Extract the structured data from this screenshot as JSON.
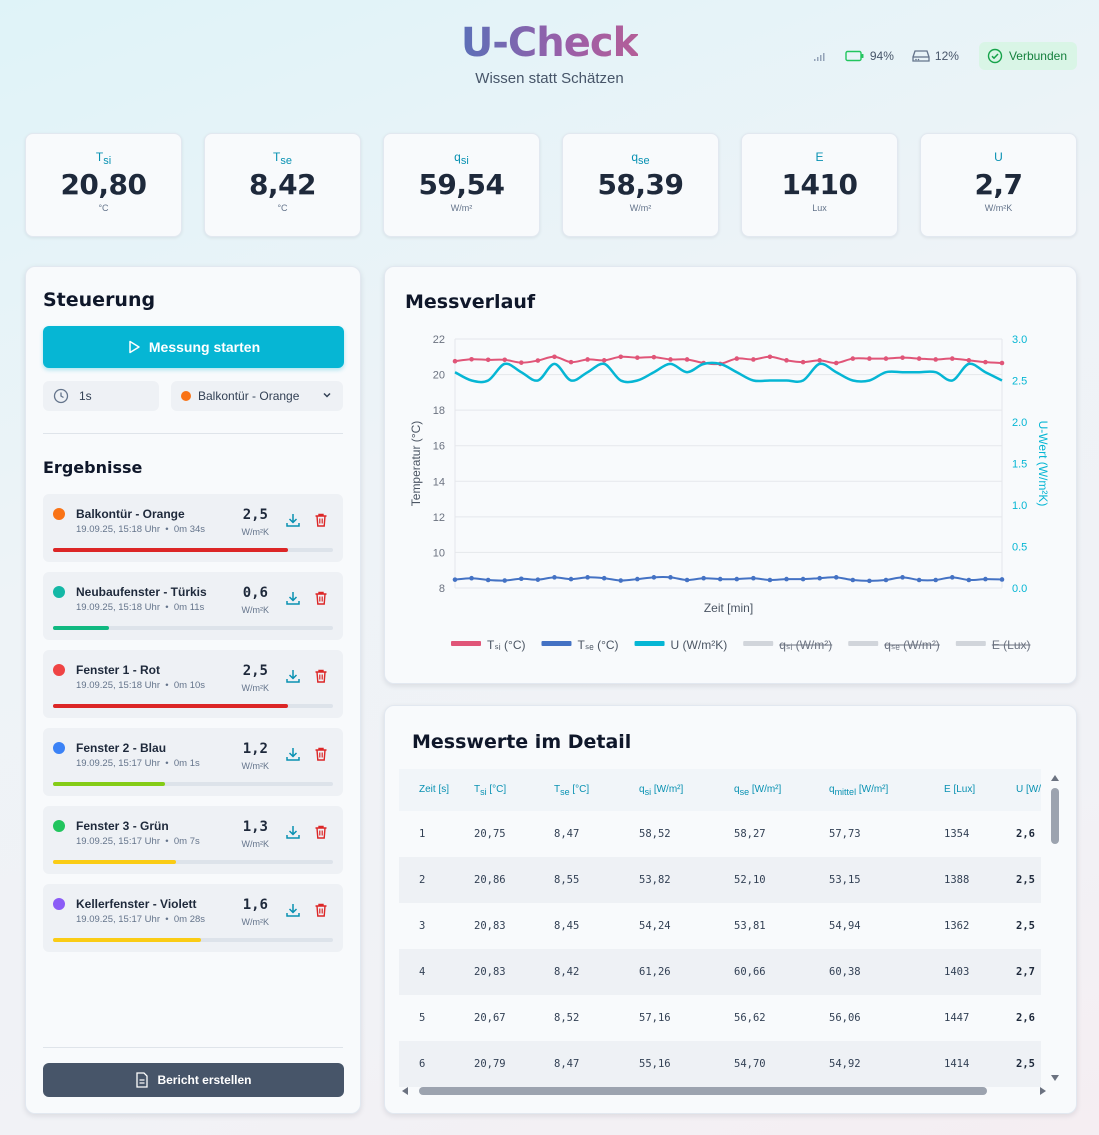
{
  "header": {
    "title": "U-Check",
    "tagline": "Wissen statt Schätzen",
    "battery": "94%",
    "storage": "12%",
    "connection": "Verbunden"
  },
  "metrics": [
    {
      "label": "T",
      "sub": "si",
      "value": "20,80",
      "unit": "°C"
    },
    {
      "label": "T",
      "sub": "se",
      "value": "8,42",
      "unit": "°C"
    },
    {
      "label": "q",
      "sub": "si",
      "value": "59,54",
      "unit": "W/m²"
    },
    {
      "label": "q",
      "sub": "se",
      "value": "58,39",
      "unit": "W/m²"
    },
    {
      "label": "E",
      "sub": "",
      "value": "1410",
      "unit": "Lux"
    },
    {
      "label": "U",
      "sub": "",
      "value": "2,7",
      "unit": "W/m²K"
    }
  ],
  "control": {
    "title": "Steuerung",
    "start_label": "Messung starten",
    "interval": "1s",
    "selected_object": "Balkontür - Orange",
    "results_title": "Ergebnisse",
    "report_label": "Bericht erstellen"
  },
  "results": [
    {
      "name": "Balkontür - Orange",
      "meta": "19.09.25, 15:18 Uhr  •  0m 34s",
      "value": "2,5",
      "unit": "W/m²K",
      "dot": "#f97316",
      "bar": "#dc2626",
      "fill": 0.84
    },
    {
      "name": "Neubaufenster - Türkis",
      "meta": "19.09.25, 15:18 Uhr  •  0m 11s",
      "value": "0,6",
      "unit": "W/m²K",
      "dot": "#14b8a6",
      "bar": "#10b981",
      "fill": 0.2
    },
    {
      "name": "Fenster 1 - Rot",
      "meta": "19.09.25, 15:18 Uhr  •  0m 10s",
      "value": "2,5",
      "unit": "W/m²K",
      "dot": "#ef4444",
      "bar": "#dc2626",
      "fill": 0.84
    },
    {
      "name": "Fenster 2 - Blau",
      "meta": "19.09.25, 15:17 Uhr  •  0m 1s",
      "value": "1,2",
      "unit": "W/m²K",
      "dot": "#3b82f6",
      "bar": "#84cc16",
      "fill": 0.4
    },
    {
      "name": "Fenster 3 - Grün",
      "meta": "19.09.25, 15:17 Uhr  •  0m 7s",
      "value": "1,3",
      "unit": "W/m²K",
      "dot": "#22c55e",
      "bar": "#facc15",
      "fill": 0.44
    },
    {
      "name": "Kellerfenster - Violett",
      "meta": "19.09.25, 15:17 Uhr  •  0m 28s",
      "value": "1,6",
      "unit": "W/m²K",
      "dot": "#8b5cf6",
      "bar": "#facc15",
      "fill": 0.53
    }
  ],
  "chart_title": "Messverlauf",
  "chart_data": {
    "type": "line",
    "title": "Messverlauf",
    "xlabel": "Zeit [min]",
    "ylabel": "Temperatur (°C)",
    "y2label": "U-Wert (W/m²K)",
    "ylim": [
      8,
      22
    ],
    "y2lim": [
      0,
      3
    ],
    "yticks": [
      "22",
      "20",
      "18",
      "16",
      "14",
      "12",
      "10",
      "8"
    ],
    "y2ticks": [
      "3.0",
      "2.5",
      "2.0",
      "1.5",
      "1.0",
      "0.5",
      "0.0"
    ],
    "grid": true,
    "legend_position": "bottom",
    "x": [
      1,
      2,
      3,
      4,
      5,
      6,
      7,
      8,
      9,
      10,
      11,
      12,
      13,
      14,
      15,
      16,
      17,
      18,
      19,
      20,
      21,
      22,
      23,
      24,
      25,
      26,
      27,
      28,
      29,
      30,
      31,
      32,
      33,
      34
    ],
    "series": [
      {
        "name": "Tₛᵢ (°C)",
        "axis": "left",
        "color": "#e05578",
        "markers": true,
        "values": [
          20.75,
          20.86,
          20.83,
          20.83,
          20.67,
          20.79,
          21.0,
          20.7,
          20.85,
          20.8,
          21.0,
          20.95,
          20.98,
          20.85,
          20.85,
          20.65,
          20.6,
          20.9,
          20.85,
          21.0,
          20.8,
          20.7,
          20.8,
          20.65,
          20.9,
          20.9,
          20.9,
          20.95,
          20.9,
          20.85,
          20.9,
          20.8,
          20.7,
          20.65
        ]
      },
      {
        "name": "Tₛₑ (°C)",
        "axis": "left",
        "color": "#4472c4",
        "markers": true,
        "values": [
          8.47,
          8.55,
          8.45,
          8.42,
          8.52,
          8.47,
          8.6,
          8.5,
          8.6,
          8.55,
          8.42,
          8.5,
          8.6,
          8.6,
          8.45,
          8.55,
          8.5,
          8.5,
          8.55,
          8.45,
          8.5,
          8.5,
          8.55,
          8.6,
          8.45,
          8.4,
          8.45,
          8.6,
          8.45,
          8.45,
          8.6,
          8.45,
          8.5,
          8.48
        ]
      },
      {
        "name": "U (W/m²K)",
        "axis": "right",
        "color": "#06b6d4",
        "markers": false,
        "values": [
          2.6,
          2.5,
          2.5,
          2.7,
          2.6,
          2.5,
          2.7,
          2.5,
          2.6,
          2.7,
          2.5,
          2.5,
          2.6,
          2.7,
          2.6,
          2.7,
          2.7,
          2.6,
          2.5,
          2.5,
          2.5,
          2.5,
          2.7,
          2.6,
          2.5,
          2.5,
          2.6,
          2.6,
          2.6,
          2.6,
          2.5,
          2.7,
          2.6,
          2.5
        ]
      },
      {
        "name": "qₛᵢ (W/m²)",
        "hidden": true,
        "color": "#d1d5db",
        "values": []
      },
      {
        "name": "qₛₑ (W/m²)",
        "hidden": true,
        "color": "#d1d5db",
        "values": []
      },
      {
        "name": "E (Lux)",
        "hidden": true,
        "color": "#d1d5db",
        "values": []
      }
    ]
  },
  "table": {
    "title": "Messwerte im Detail",
    "headers": [
      {
        "main": "Zeit [s]",
        "sub": "",
        "rest": ""
      },
      {
        "main": "T",
        "sub": "si",
        "rest": " [°C]"
      },
      {
        "main": "T",
        "sub": "se",
        "rest": " [°C]"
      },
      {
        "main": "q",
        "sub": "si",
        "rest": " [W/m²]"
      },
      {
        "main": "q",
        "sub": "se",
        "rest": " [W/m²]"
      },
      {
        "main": "q",
        "sub": "mittel",
        "rest": " [W/m²]"
      },
      {
        "main": "E [Lux]",
        "sub": "",
        "rest": ""
      },
      {
        "main": "U [W/",
        "sub": "",
        "rest": ""
      }
    ],
    "rows": [
      [
        "1",
        "20,75",
        "8,47",
        "58,52",
        "58,27",
        "57,73",
        "1354",
        "2,6"
      ],
      [
        "2",
        "20,86",
        "8,55",
        "53,82",
        "52,10",
        "53,15",
        "1388",
        "2,5"
      ],
      [
        "3",
        "20,83",
        "8,45",
        "54,24",
        "53,81",
        "54,94",
        "1362",
        "2,5"
      ],
      [
        "4",
        "20,83",
        "8,42",
        "61,26",
        "60,66",
        "60,38",
        "1403",
        "2,7"
      ],
      [
        "5",
        "20,67",
        "8,52",
        "57,16",
        "56,62",
        "56,06",
        "1447",
        "2,6"
      ],
      [
        "6",
        "20,79",
        "8,47",
        "55,16",
        "54,70",
        "54,92",
        "1414",
        "2,5"
      ]
    ]
  }
}
